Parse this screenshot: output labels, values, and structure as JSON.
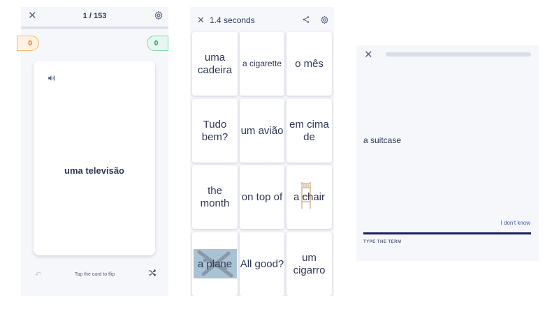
{
  "flashcards": {
    "close_icon": "✕",
    "counter": "1 / 153",
    "score_left": "0",
    "score_right": "0",
    "card_term": "uma televisão",
    "undo_icon": "↶",
    "hint": "Tap the card to flip",
    "colors": {
      "still_learning": "#d46a00",
      "know": "#139a61"
    }
  },
  "match": {
    "close_icon": "✕",
    "timer": "1.4 seconds",
    "tiles": [
      {
        "text": "uma cadeira"
      },
      {
        "text": "a cigarette",
        "small": true
      },
      {
        "text": "o mês"
      },
      {
        "text": "Tudo bem?"
      },
      {
        "text": "um avião"
      },
      {
        "text": "em cima de"
      },
      {
        "text": "the month"
      },
      {
        "text": "on top of"
      },
      {
        "text": "a chair",
        "image": "chair"
      },
      {
        "text": "a plane",
        "image": "plane"
      },
      {
        "text": "All good?"
      },
      {
        "text": "um cigarro"
      }
    ]
  },
  "write": {
    "close_icon": "✕",
    "prompt": "a suitcase",
    "dont_know": "I don't know",
    "field_label": "TYPE THE TERM",
    "colors": {
      "accent": "#1a1d66",
      "link": "#4257b2"
    }
  }
}
